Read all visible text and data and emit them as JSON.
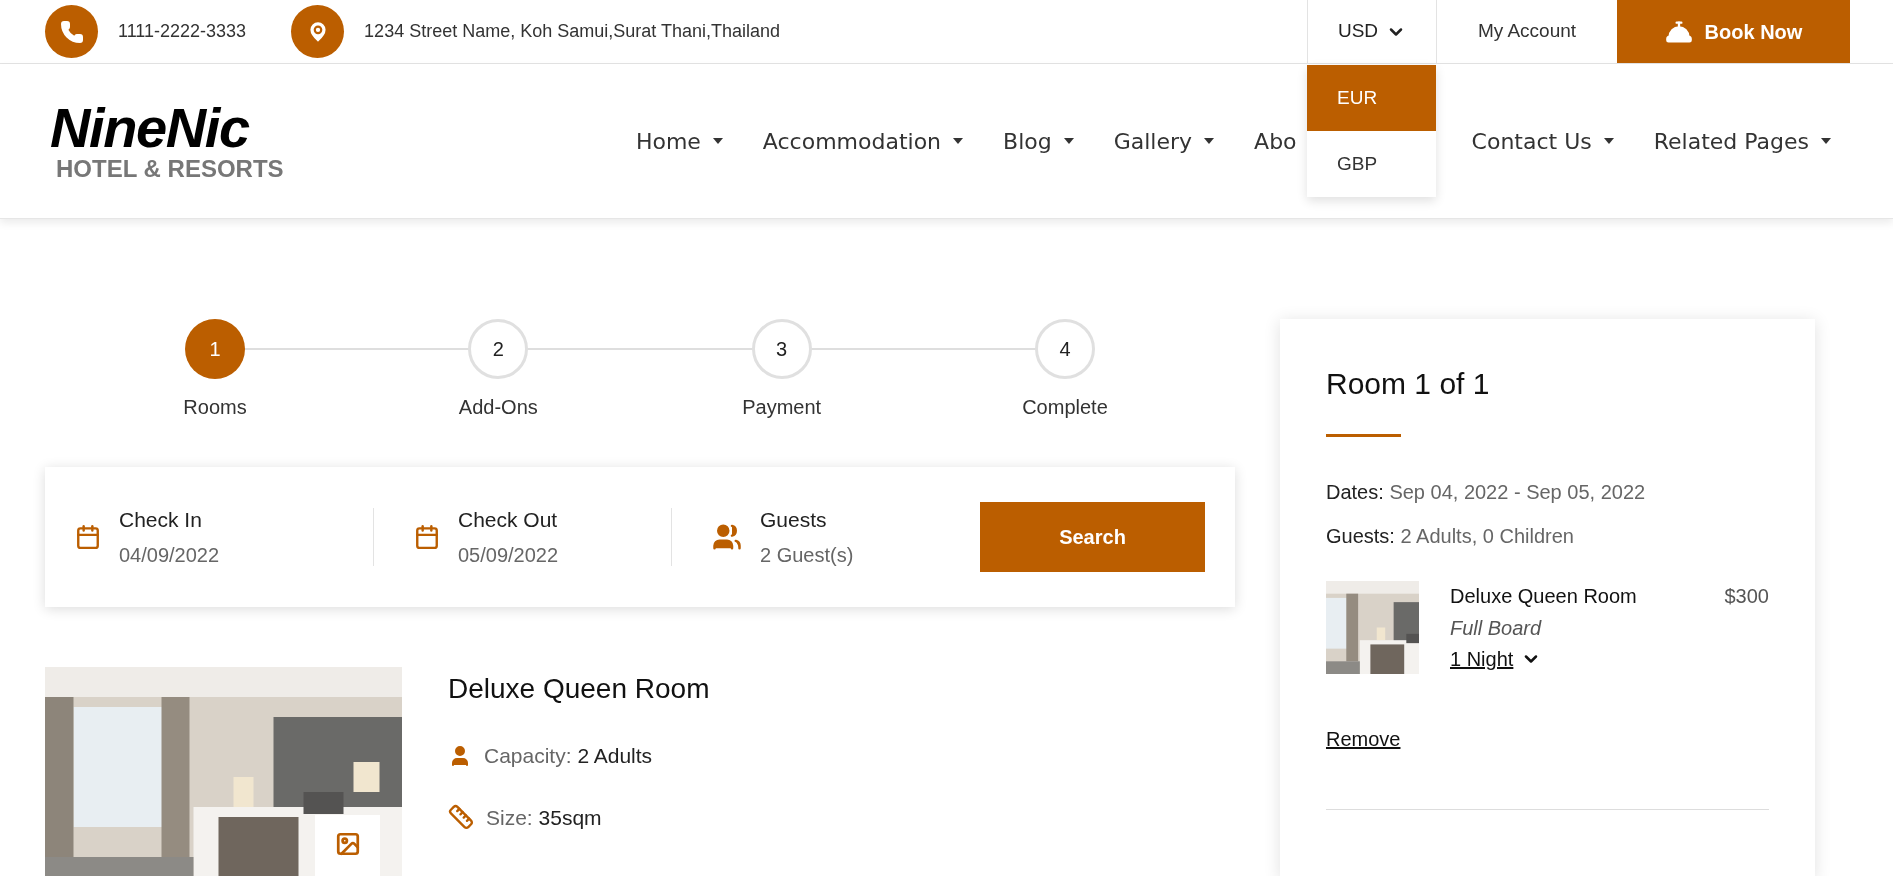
{
  "top_bar": {
    "phone": "1111-2222-3333",
    "address": "1234 Street Name, Koh Samui,Surat Thani,Thailand",
    "currency": {
      "label": "USD",
      "expanded": true,
      "options": [
        {
          "label": "EUR",
          "selected": true
        },
        {
          "label": "GBP",
          "selected": false
        }
      ]
    },
    "account": "My Account",
    "book_button": "Book Now"
  },
  "logo": {
    "name": "NineNic",
    "tagline": "HOTEL & RESORTS"
  },
  "nav": [
    {
      "label": "Home",
      "caret_shown": true
    },
    {
      "label": "Accommodation",
      "caret_shown": true
    },
    {
      "label": "Blog",
      "caret_shown": true
    },
    {
      "label": "Gallery",
      "caret_shown": true
    },
    {
      "label": "Abo",
      "caret_shown": false
    },
    {
      "label": "Contact Us",
      "caret_shown": true
    },
    {
      "label": "Related Pages",
      "caret_shown": true
    }
  ],
  "steps": [
    {
      "number": "1",
      "label": "Rooms",
      "selected": true
    },
    {
      "number": "2",
      "label": "Add-Ons",
      "selected": false
    },
    {
      "number": "3",
      "label": "Payment",
      "selected": false
    },
    {
      "number": "4",
      "label": "Complete",
      "selected": false
    }
  ],
  "search": {
    "fields": [
      {
        "kind": "date",
        "label": "Check In",
        "value": "04/09/2022"
      },
      {
        "kind": "date",
        "label": "Check Out",
        "value": "05/09/2022"
      },
      {
        "kind": "guests",
        "label": "Guests",
        "value": "2 Guest(s)"
      }
    ],
    "button": "Search"
  },
  "rooms": [
    {
      "name": "Deluxe Queen Room",
      "details": [
        {
          "kind": "capacity",
          "label": "Capacity:",
          "value": "2 Adults"
        },
        {
          "kind": "size",
          "label": "Size:",
          "value": "35sqm"
        }
      ]
    }
  ],
  "summary": {
    "title": "Room 1 of 1",
    "dates_label": "Dates:",
    "dates": "Sep 04, 2022 - Sep 05, 2022",
    "guests_label": "Guests:",
    "guests": "2 Adults, 0 Children",
    "item": {
      "name": "Deluxe Queen Room",
      "board": "Full Board",
      "nights": "1 Night",
      "price": "$300"
    },
    "remove": "Remove"
  }
}
